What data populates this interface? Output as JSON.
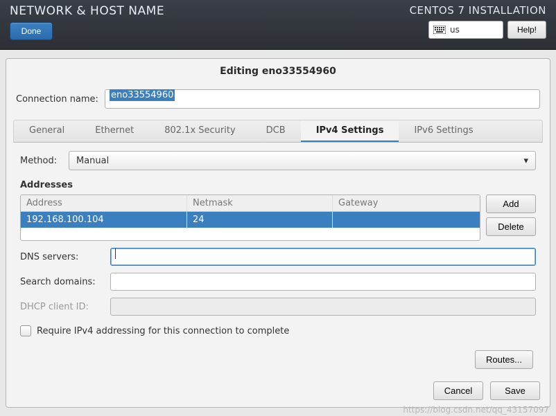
{
  "topbar": {
    "title": "NETWORK & HOST NAME",
    "done": "Done",
    "install": "CENTOS 7 INSTALLATION",
    "kbd": "us",
    "help": "Help!"
  },
  "dialog": {
    "title": "Editing eno33554960",
    "conn_label": "Connection name:",
    "conn_value": "eno33554960"
  },
  "tabs": {
    "general": "General",
    "ethernet": "Ethernet",
    "dot1x": "802.1x Security",
    "dcb": "DCB",
    "ipv4": "IPv4 Settings",
    "ipv6": "IPv6 Settings"
  },
  "ipv4": {
    "method_label": "Method:",
    "method_value": "Manual",
    "addresses_heading": "Addresses",
    "cols": {
      "address": "Address",
      "netmask": "Netmask",
      "gateway": "Gateway"
    },
    "row": {
      "address": "192.168.100.104",
      "netmask": "24",
      "gateway": ""
    },
    "add": "Add",
    "delete": "Delete",
    "dns_label": "DNS servers:",
    "dns_value": "",
    "search_label": "Search domains:",
    "search_value": "",
    "dhcp_label": "DHCP client ID:",
    "dhcp_value": "",
    "require_label": "Require IPv4 addressing for this connection to complete",
    "routes": "Routes..."
  },
  "actions": {
    "cancel": "Cancel",
    "save": "Save"
  },
  "watermark": "https://blog.csdn.net/qq_43157097"
}
